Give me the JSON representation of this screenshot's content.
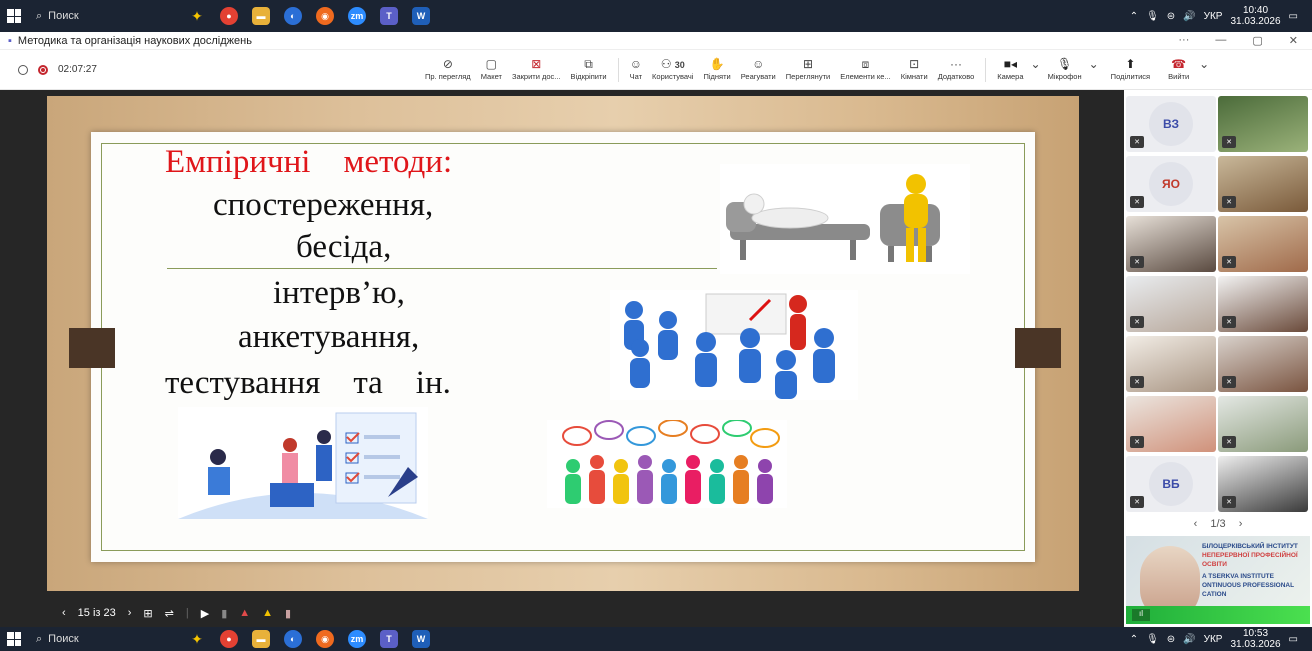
{
  "taskbar_top": {
    "search_placeholder": "Поиск",
    "tray_lang": "УКР",
    "clock_time": "10:40",
    "clock_date": "31.03.2026"
  },
  "taskbar_bottom": {
    "search_placeholder": "Поиск",
    "tray_lang": "УКР",
    "clock_time": "10:53",
    "clock_date": "31.03.2026"
  },
  "window": {
    "title": "Методика та організація наукових досліджень",
    "controls": [
      "···",
      "—",
      "▢",
      "✕"
    ]
  },
  "meeting": {
    "timer": "02:07:27",
    "tools": [
      {
        "icon": "eye-off-icon",
        "label": "Пр. перегляд"
      },
      {
        "icon": "layout-icon",
        "label": "Макет"
      },
      {
        "icon": "close-share-icon",
        "label": "Закрити дос..."
      },
      {
        "icon": "popout-icon",
        "label": "Відкріпити"
      },
      {
        "icon": "chat-icon",
        "label": "Чат"
      },
      {
        "icon": "people-icon",
        "label": "Користувачі"
      },
      {
        "icon": "raise-hand-icon",
        "label": "Підняти"
      },
      {
        "icon": "react-icon",
        "label": "Реагувати"
      },
      {
        "icon": "view-icon",
        "label": "Переглянути"
      },
      {
        "icon": "apps-icon",
        "label": "Елементи ке..."
      },
      {
        "icon": "rooms-icon",
        "label": "Кімнати"
      },
      {
        "icon": "more-icon",
        "label": "Додатково"
      }
    ],
    "participants_count": "30",
    "camera_label": "Камера",
    "mic_label": "Мікрофон",
    "share_label": "Поділитися",
    "leave_label": "Вийти"
  },
  "slide": {
    "title": "Емпіричні    методи:",
    "lines": [
      "спостереження,",
      "бесіда,",
      "інтерв’ю,",
      "анкетування,",
      "тестування    та    ін."
    ],
    "colors": {
      "title": "#e0161a",
      "text": "#111111",
      "frame": "#8a9b5a"
    }
  },
  "presenter": {
    "page": "15 із 23"
  },
  "gallery": {
    "tiles": [
      {
        "initials": "ВЗ"
      },
      {
        "initials": ""
      },
      {
        "initials": "ЯО"
      },
      {
        "initials": ""
      },
      {
        "initials": ""
      },
      {
        "initials": ""
      },
      {
        "initials": ""
      },
      {
        "initials": ""
      },
      {
        "initials": ""
      },
      {
        "initials": ""
      },
      {
        "initials": ""
      },
      {
        "initials": ""
      },
      {
        "initials": "ВБ"
      },
      {
        "initials": ""
      }
    ],
    "page": "1/3",
    "speaker_banner": [
      "БІЛОЦЕРКІВСЬКИЙ ІНСТИТУТ",
      "НЕПЕРЕРВНОЇ ПРОФЕСІЙНОЇ ОСВІТИ",
      "A TSERKVA INSTITUTE",
      "ONTINUOUS PROFESSIONAL",
      "CATION"
    ]
  }
}
